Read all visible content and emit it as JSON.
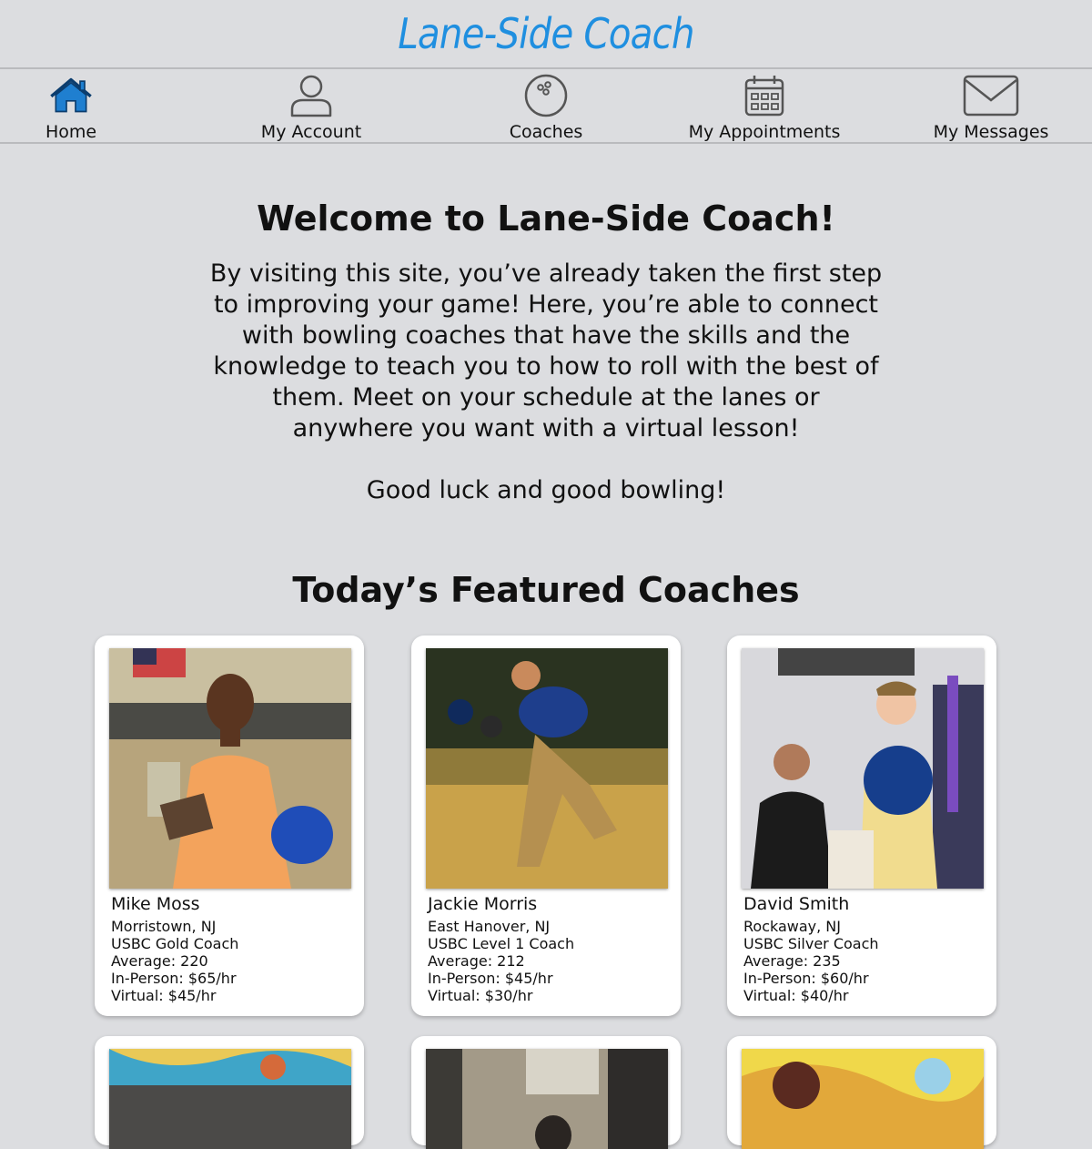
{
  "app": {
    "title": "Lane-Side Coach"
  },
  "nav": [
    {
      "label": "Home",
      "icon": "home-icon"
    },
    {
      "label": "My Account",
      "icon": "account-icon"
    },
    {
      "label": "Coaches",
      "icon": "bowling-ball-icon"
    },
    {
      "label": "My Appointments",
      "icon": "calendar-icon"
    },
    {
      "label": "My Messages",
      "icon": "envelope-icon"
    }
  ],
  "welcome": {
    "heading": "Welcome to Lane-Side Coach!",
    "body": "By visiting this site, you’ve already taken the first step to improving your game! Here, you’re able to connect with bowling coaches that have the skills and the knowledge to teach you to how to roll with the best of them. Meet on your schedule at the lanes or anywhere you want with a virtual lesson!",
    "signoff": "Good luck and good bowling!"
  },
  "featured": {
    "heading": "Today’s Featured Coaches",
    "coaches": [
      {
        "name": "Mike Moss",
        "location": "Morristown, NJ",
        "level": "USBC Gold Coach",
        "average": "Average: 220",
        "in_person": "In-Person: $65/hr",
        "virtual": "Virtual: $45/hr"
      },
      {
        "name": "Jackie Morris",
        "location": "East Hanover, NJ",
        "level": "USBC Level 1 Coach",
        "average": "Average: 212",
        "in_person": "In-Person: $45/hr",
        "virtual": "Virtual: $30/hr"
      },
      {
        "name": "David Smith",
        "location": "Rockaway, NJ",
        "level": "USBC Silver Coach",
        "average": "Average: 235",
        "in_person": "In-Person: $60/hr",
        "virtual": "Virtual: $40/hr"
      }
    ]
  },
  "colors": {
    "brand": "#1f8fe0",
    "background": "#dcdde0",
    "home_icon": "#1f7fd0"
  }
}
